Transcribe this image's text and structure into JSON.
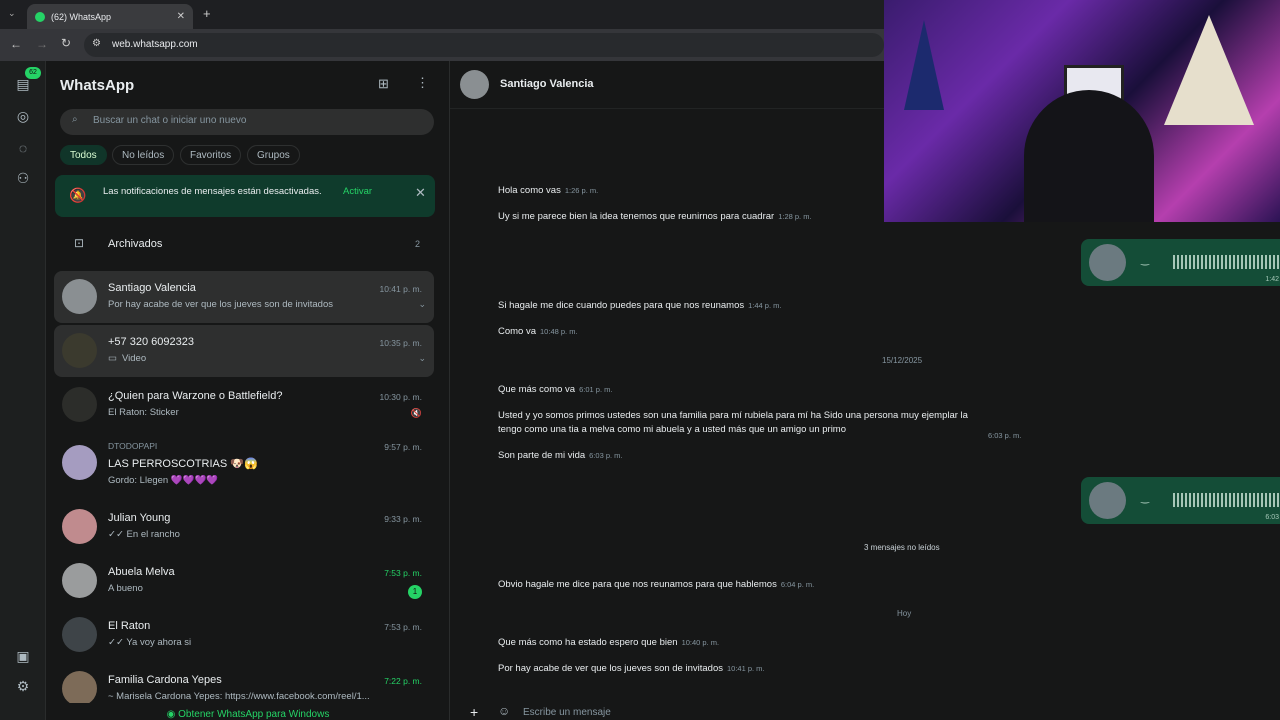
{
  "browser": {
    "tab_title": "(62) WhatsApp",
    "url": "web.whatsapp.com"
  },
  "rail": {
    "chats_badge": "62"
  },
  "sidebar": {
    "title": "WhatsApp",
    "search_placeholder": "Buscar un chat o iniciar uno nuevo",
    "filters": [
      "Todos",
      "No leídos",
      "Favoritos",
      "Grupos"
    ],
    "notification": {
      "text": "Las notificaciones de mensajes están desactivadas.",
      "action": "Activar"
    },
    "archived": {
      "label": "Archivados",
      "count": "2"
    },
    "chats": [
      {
        "name": "Santiago Valencia",
        "message": "Por hay acabe de ver que los jueves son de invitados",
        "time": "10:41 p. m."
      },
      {
        "name": "+57 320 6092323",
        "message": "Video",
        "time": "10:35 p. m."
      },
      {
        "name": "¿Quien para Warzone o Battlefield?",
        "message": "El Raton: Sticker",
        "time": "10:30 p. m."
      },
      {
        "group_label": "DTODOPAPI",
        "name": "LAS PERROSCOTRIAS 🐶😱",
        "message": "Gordo: Llegen 💜💜💜💜",
        "time": "9:57 p. m."
      },
      {
        "name": "Julian Young",
        "message": "✓✓ En el rancho",
        "time": "9:33 p. m."
      },
      {
        "name": "Abuela Melva",
        "message": "A bueno",
        "time": "7:53 p. m.",
        "unread": "1"
      },
      {
        "name": "El Raton",
        "message": "✓✓ Ya voy ahora si",
        "time": "7:53 p. m."
      },
      {
        "name": "Familia Cardona Yepes",
        "message": "~ Marisela Cardona Yepes: https://www.facebook.com/reel/1...",
        "time": "7:22 p. m."
      }
    ],
    "footer_link": "Obtener WhatsApp para Windows"
  },
  "chat": {
    "contact": "Santiago Valencia",
    "messages": [
      {
        "text": "Hola como vas",
        "time": "1:26 p. m."
      },
      {
        "text": "Uy si me parece bien la idea tenemos que reunirnos para cuadrar",
        "time": "1:28 p. m."
      },
      {
        "text": "Si hagale me dice cuando puedes para que nos reunamos",
        "time": "1:44 p. m."
      },
      {
        "text": "Como va",
        "time": "10:48 p. m."
      },
      {
        "text": "Que más como va",
        "time": "6:01 p. m."
      },
      {
        "text": "Usted y yo somos primos ustedes son una familia para mí rubiela para mí ha Sido una persona muy ejemplar la",
        "text2": "tengo como una tia a melva como mi abuela y a usted más que un amigo un primo",
        "time": "6:03 p. m."
      },
      {
        "text": "Son parte de mi vida",
        "time": "6:03 p. m."
      },
      {
        "text": "Obvio hagale me dice para que nos reunamos para que hablemos",
        "time": "6:04 p. m."
      },
      {
        "text": "Que más como ha estado espero que bien",
        "time": "10:40 p. m."
      },
      {
        "text": "Por hay acabe de ver que los jueves son de invitados",
        "time": "10:41 p. m."
      }
    ],
    "date_sep_1": "15/12/2025",
    "unread_sep": "3 mensajes no leídos",
    "date_sep_2": "Hoy",
    "voice_times": [
      "1:42",
      "6:03"
    ],
    "compose_placeholder": "Escribe un mensaje"
  },
  "colors": {
    "accent": "#25d366",
    "outgoing": "#144d37",
    "background": "#161717"
  }
}
